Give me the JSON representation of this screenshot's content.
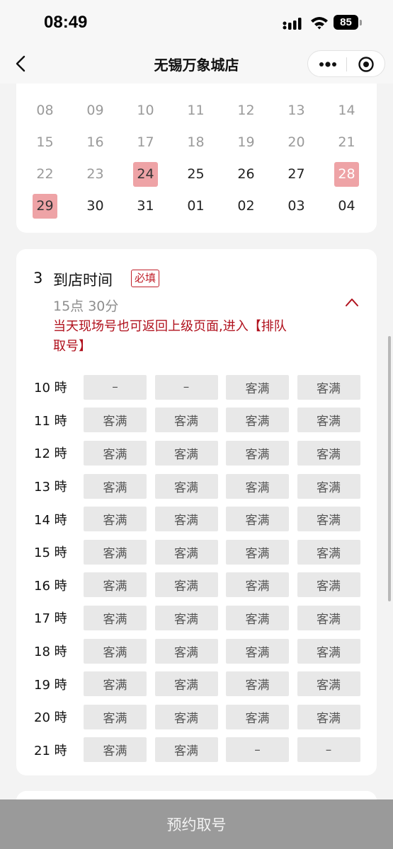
{
  "status": {
    "time": "08:49",
    "battery": "85"
  },
  "nav": {
    "title": "无锡万象城店",
    "back_icon": "chevron-left-icon",
    "more_icon": "more-dots-icon",
    "close_icon": "target-circle-icon"
  },
  "calendar": {
    "rows": [
      [
        {
          "d": "08",
          "s": "past"
        },
        {
          "d": "09",
          "s": "past"
        },
        {
          "d": "10",
          "s": "past"
        },
        {
          "d": "11",
          "s": "past"
        },
        {
          "d": "12",
          "s": "past"
        },
        {
          "d": "13",
          "s": "past"
        },
        {
          "d": "14",
          "s": "past"
        }
      ],
      [
        {
          "d": "15",
          "s": "past"
        },
        {
          "d": "16",
          "s": "past"
        },
        {
          "d": "17",
          "s": "past"
        },
        {
          "d": "18",
          "s": "past"
        },
        {
          "d": "19",
          "s": "past"
        },
        {
          "d": "20",
          "s": "past"
        },
        {
          "d": "21",
          "s": "past"
        }
      ],
      [
        {
          "d": "22",
          "s": "past"
        },
        {
          "d": "23",
          "s": "past"
        },
        {
          "d": "24",
          "s": "sel"
        },
        {
          "d": "25",
          "s": "avail"
        },
        {
          "d": "26",
          "s": "avail"
        },
        {
          "d": "27",
          "s": "avail"
        },
        {
          "d": "28",
          "s": "holiday"
        }
      ],
      [
        {
          "d": "29",
          "s": "sel"
        },
        {
          "d": "30",
          "s": "avail"
        },
        {
          "d": "31",
          "s": "avail"
        },
        {
          "d": "01",
          "s": "avail"
        },
        {
          "d": "02",
          "s": "avail"
        },
        {
          "d": "03",
          "s": "avail"
        },
        {
          "d": "04",
          "s": "avail"
        }
      ]
    ],
    "highlight_color": "#eea3a6"
  },
  "arrival": {
    "step": "3",
    "title": "到店时间",
    "required": "必填",
    "selected": "15点 30分",
    "notice": "当天现场号也可返回上级页面,进入【排队取号】",
    "notice_color": "#b0101c"
  },
  "slots": [
    {
      "hour": "10 時",
      "cells": [
        "–",
        "–",
        "客满",
        "客满"
      ]
    },
    {
      "hour": "11 時",
      "cells": [
        "客满",
        "客满",
        "客满",
        "客满"
      ]
    },
    {
      "hour": "12 時",
      "cells": [
        "客满",
        "客满",
        "客满",
        "客满"
      ]
    },
    {
      "hour": "13 時",
      "cells": [
        "客满",
        "客满",
        "客满",
        "客满"
      ]
    },
    {
      "hour": "14 時",
      "cells": [
        "客满",
        "客满",
        "客满",
        "客满"
      ]
    },
    {
      "hour": "15 時",
      "cells": [
        "客满",
        "客满",
        "客满",
        "客满"
      ]
    },
    {
      "hour": "16 時",
      "cells": [
        "客满",
        "客满",
        "客满",
        "客满"
      ]
    },
    {
      "hour": "17 時",
      "cells": [
        "客满",
        "客满",
        "客满",
        "客满"
      ]
    },
    {
      "hour": "18 時",
      "cells": [
        "客满",
        "客满",
        "客满",
        "客满"
      ]
    },
    {
      "hour": "19 時",
      "cells": [
        "客满",
        "客满",
        "客满",
        "客满"
      ]
    },
    {
      "hour": "20 時",
      "cells": [
        "客满",
        "客满",
        "客满",
        "客满"
      ]
    },
    {
      "hour": "21 時",
      "cells": [
        "客满",
        "客满",
        "–",
        "–"
      ]
    }
  ],
  "footer": {
    "button": "预约取号"
  }
}
